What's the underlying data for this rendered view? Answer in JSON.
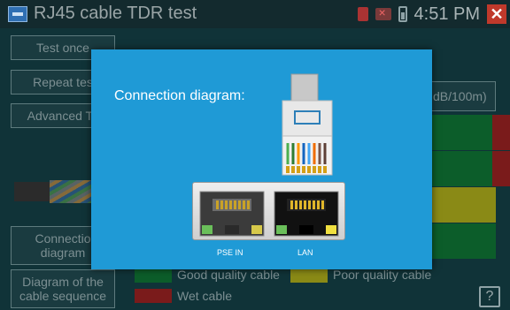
{
  "app": {
    "title": "RJ45 cable TDR test",
    "time": "4:51 PM"
  },
  "sidebar": {
    "test_once": "Test once",
    "repeat_test": "Repeat tes",
    "advanced_test": "Advanced Te",
    "connection_diagram": "Connectio\ndiagram",
    "cable_sequence": "Diagram of the cable sequence"
  },
  "panel": {
    "unit_label": "dB/100m)"
  },
  "legend": {
    "good": "Good quality cable",
    "poor": "Poor quality cable",
    "wet": "Wet cable"
  },
  "help_label": "?",
  "modal": {
    "title": "Connection diagram:",
    "port_left": "PSE IN",
    "port_right": "LAN"
  },
  "colors": {
    "modal_bg": "#1f9ad6",
    "good": "#0c5d2a",
    "poor": "#8a8a16",
    "wet": "#7a1b1b",
    "close": "#c0392b"
  },
  "icons": [
    "app-icon",
    "sd-card-icon",
    "network-off-icon",
    "battery-icon",
    "close-icon",
    "help-icon",
    "rj45-plug-icon",
    "ethernet-port-icon"
  ]
}
